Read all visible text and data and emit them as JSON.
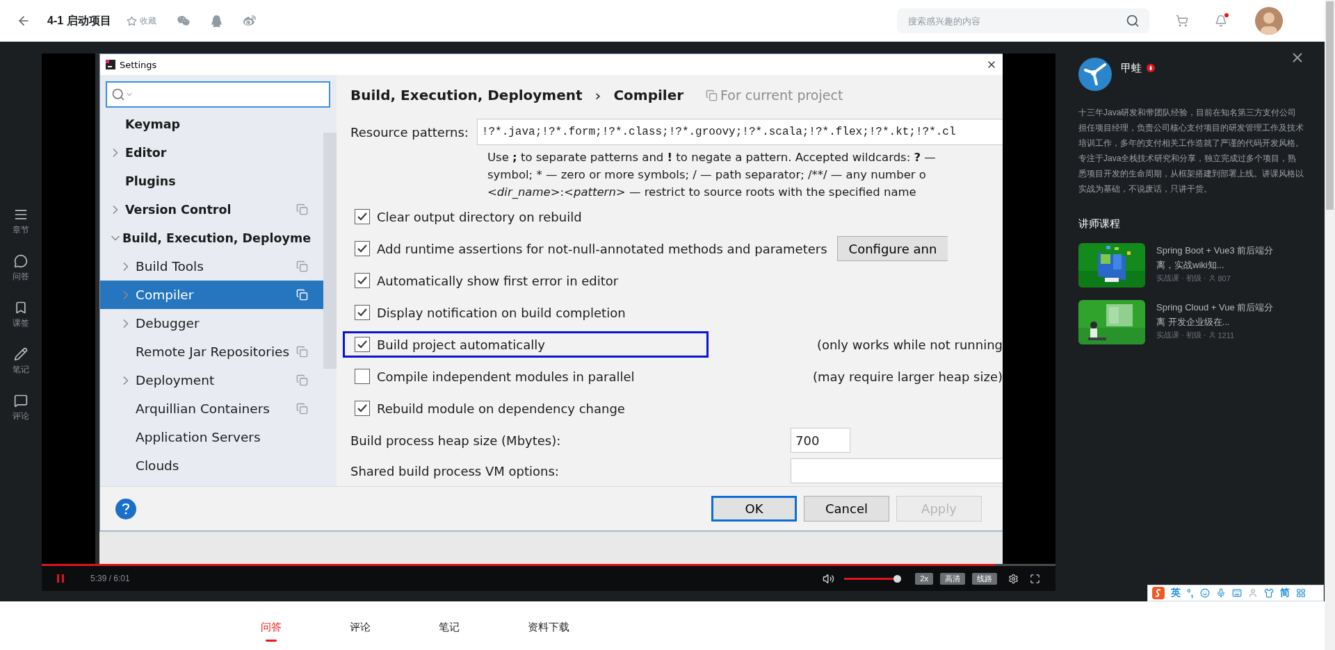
{
  "header": {
    "title": "4-1 启动项目",
    "favorite_label": "收藏",
    "search": {
      "placeholder": "搜索感兴趣的内容"
    },
    "notification_dot": true
  },
  "side_nav": [
    {
      "kind": "chapters",
      "label": "章节"
    },
    {
      "kind": "qa",
      "label": "问答"
    },
    {
      "kind": "bookmark",
      "label": "课签"
    },
    {
      "kind": "notes",
      "label": "笔记"
    },
    {
      "kind": "comments",
      "label": "评论"
    }
  ],
  "video": {
    "dialog": {
      "title": "Settings",
      "tree": [
        {
          "label": "Keymap",
          "selected": false,
          "project_level": false
        },
        {
          "label": "Editor",
          "expanded": false,
          "selected": false,
          "project_level": false
        },
        {
          "label": "Plugins",
          "selected": false,
          "project_level": false
        },
        {
          "label": "Version Control",
          "expanded": false,
          "selected": false,
          "project_level": true
        },
        {
          "label": "Build, Execution, Deployme",
          "expanded": true,
          "selected": false,
          "project_level": false,
          "children": [
            {
              "label": "Build Tools",
              "expanded": false,
              "selected": false,
              "project_level": true
            },
            {
              "label": "Compiler",
              "expanded": false,
              "selected": true,
              "project_level": true
            },
            {
              "label": "Debugger",
              "expanded": false,
              "selected": false,
              "project_level": false
            },
            {
              "label": "Remote Jar Repositories",
              "selected": false,
              "project_level": true
            },
            {
              "label": "Deployment",
              "expanded": false,
              "selected": false,
              "project_level": true
            },
            {
              "label": "Arquillian Containers",
              "selected": false,
              "project_level": true
            },
            {
              "label": "Application Servers",
              "selected": false,
              "project_level": false
            },
            {
              "label": "Clouds",
              "selected": false,
              "project_level": false
            }
          ]
        }
      ],
      "breadcrumb": [
        "Build, Execution, Deployment",
        "Compiler"
      ],
      "breadcrumb_separator": "›",
      "scope": "For current project",
      "resource_patterns": {
        "label": "Resource patterns:",
        "value": "!?*.java;!?*.form;!?*.class;!?*.groovy;!?*.scala;!?*.flex;!?*.kt;!?*.cl"
      },
      "help": [
        "Use **;** to separate patterns and **!** to negate a pattern. Accepted wildcards: **?** —",
        "symbol; * — zero or more symbols; / — path separator; /**/ — any number o",
        "*<dir_name>*:*<pattern>* — restrict to source roots with the specified name"
      ],
      "options": [
        {
          "label": "Clear output directory on rebuild",
          "checked": true,
          "highlighted": false
        },
        {
          "label": "Add runtime assertions for not-null-annotated methods and parameters",
          "checked": true,
          "highlighted": false,
          "button": "Configure ann"
        },
        {
          "label": "Automatically show first error in editor",
          "checked": true,
          "highlighted": false
        },
        {
          "label": "Display notification on build completion",
          "checked": true,
          "highlighted": false
        },
        {
          "label": "Build project automatically",
          "checked": true,
          "highlighted": true,
          "note": "(only works while not running"
        },
        {
          "label": "Compile independent modules in parallel",
          "checked": false,
          "highlighted": false,
          "note": "(may require larger heap size)"
        },
        {
          "label": "Rebuild module on dependency change",
          "checked": true,
          "highlighted": false
        }
      ],
      "heap": {
        "label": "Build process heap size (Mbytes):",
        "value": "700"
      },
      "vm_options": {
        "label": "Shared build process VM options:"
      },
      "buttons": [
        {
          "label": "OK",
          "default": true,
          "disabled": false
        },
        {
          "label": "Cancel",
          "default": false,
          "disabled": false
        },
        {
          "label": "Apply",
          "default": false,
          "disabled": true
        }
      ]
    },
    "controls": {
      "time": "5:39 / 6:01",
      "progress": {
        "level": 0.94
      },
      "volume": {
        "level": 1
      },
      "options": [
        "2x",
        "高清",
        "线路"
      ]
    }
  },
  "instructor": {
    "name": "甲蛙",
    "bio": "十三年Java研发和带团队经验，目前在知名第三方支付公司担任项目经理，负责公司核心支付项目的研发管理工作及技术培训工作，多年的支付相关工作造就了严谨的代码开发风格。专注于Java全栈技术研究和分享，独立完成过多个项目，熟悉项目开发的生命周期，从框架搭建到部署上线。讲课风格以实战为基础，不说废话，只讲干货。",
    "courses_heading": "讲师课程",
    "courses": [
      {
        "title": "Spring Boot + Vue3 前后端分离，实战wiki知...",
        "meta": "实战课 · 初级 ·",
        "students": "807"
      },
      {
        "title": "Spring Cloud + Vue 前后端分离 开发企业级在...",
        "meta": "实战课 · 初级 ·",
        "students": "1211"
      }
    ]
  },
  "tabs": [
    {
      "label": "问答",
      "selected": true
    },
    {
      "label": "评论",
      "selected": false
    },
    {
      "label": "笔记",
      "selected": false
    },
    {
      "label": "资料下载",
      "selected": false
    }
  ],
  "ime": {
    "lang": "英",
    "punct": "°,",
    "mode": "简"
  }
}
